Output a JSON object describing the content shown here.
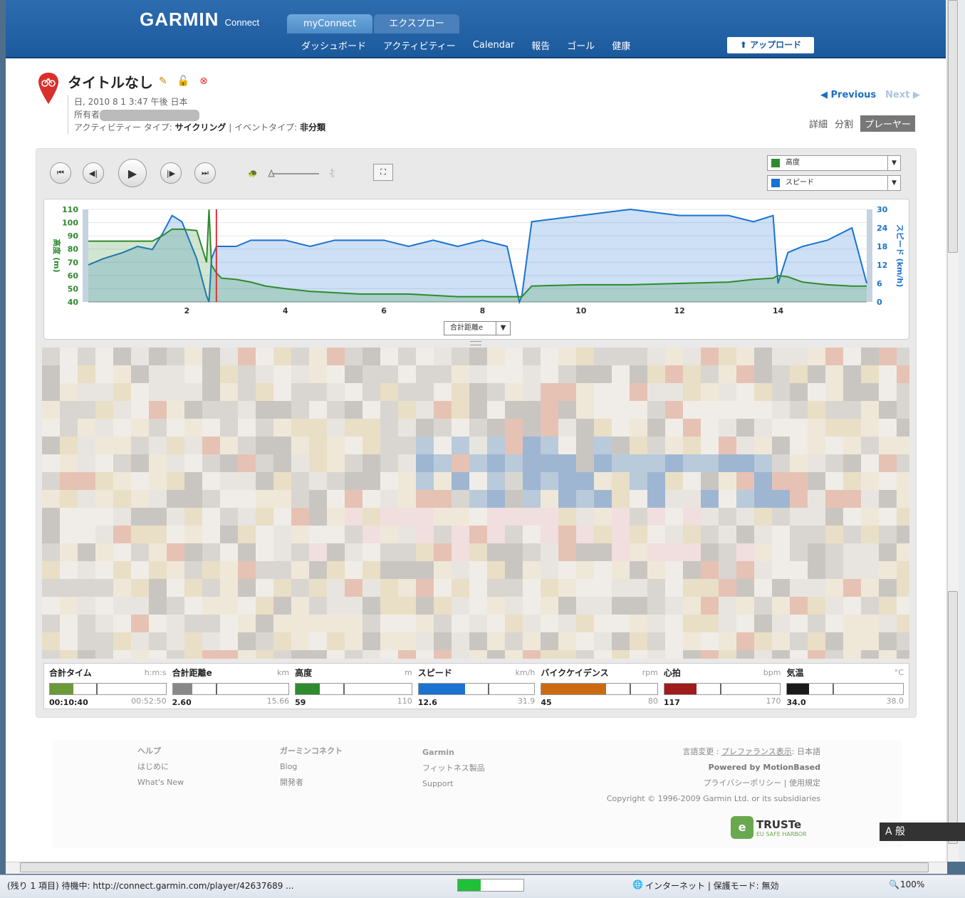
{
  "header": {
    "logo": "GARMIN",
    "logo_sub": "Connect",
    "tabs": [
      "myConnect",
      "エクスプロー"
    ],
    "nav": [
      "ダッシュボード",
      "アクティビティー",
      "Calendar",
      "報告",
      "ゴール",
      "健康"
    ],
    "upload": "アップロード"
  },
  "activity": {
    "title": "タイトルなし",
    "date": "日, 2010 8 1 3:47 午後 日本",
    "owner_label": "所有者",
    "type_label": "アクティビティー タイプ:",
    "type_value": "サイクリング",
    "event_label": "| イベントタイプ:",
    "event_value": "非分類",
    "previous": "Previous",
    "next": "Next",
    "view_tabs": [
      "詳細",
      "分割",
      "プレーヤー"
    ]
  },
  "colors": {
    "altitude": "#2e8b2e",
    "speed": "#1a73d0",
    "marker": "#d33",
    "header": "#1f5e9f"
  },
  "selectors": {
    "series1": "高度",
    "series2": "スピード",
    "xaxis": "合計距離e"
  },
  "chart_data": {
    "type": "area",
    "x": [
      0.0,
      0.3,
      0.7,
      1.0,
      1.3,
      1.5,
      1.7,
      1.9,
      2.2,
      2.4,
      2.45,
      2.5,
      2.6,
      2.7,
      3.0,
      3.3,
      3.6,
      4.0,
      4.5,
      5.0,
      5.5,
      6.0,
      6.5,
      7.0,
      7.5,
      8.0,
      8.5,
      8.75,
      8.8,
      9.0,
      10.0,
      11.0,
      12.0,
      13.0,
      13.5,
      13.9,
      14.0,
      14.2,
      14.5,
      15.0,
      15.5,
      15.8
    ],
    "series": [
      {
        "name": "高度",
        "axis": "left",
        "unit": "m",
        "values": [
          86,
          86,
          86,
          86,
          86,
          90,
          95,
          95,
          94,
          70,
          110,
          68,
          62,
          58,
          57,
          55,
          52,
          50,
          48,
          47,
          46,
          46,
          46,
          45,
          44,
          44,
          44,
          44,
          44,
          52,
          53,
          53,
          54,
          55,
          57,
          58,
          60,
          59,
          55,
          53,
          52,
          52
        ]
      },
      {
        "name": "スピード",
        "axis": "right",
        "unit": "km/h",
        "values": [
          12,
          14,
          16,
          18,
          17,
          22,
          28,
          26,
          14,
          2,
          0,
          14,
          18,
          18,
          18,
          20,
          20,
          20,
          18,
          20,
          20,
          20,
          18,
          20,
          18,
          20,
          18,
          0,
          2,
          26,
          28,
          30,
          28,
          28,
          26,
          28,
          6,
          16,
          18,
          20,
          24,
          6
        ]
      }
    ],
    "ylabel_left": "高度 (m)",
    "ylabel_right": "スピード (km/h)",
    "ylim_left": [
      40,
      110
    ],
    "ylim_right": [
      0,
      30
    ],
    "yticks_left": [
      "110",
      "100",
      "90",
      "80",
      "70",
      "60",
      "50",
      "40"
    ],
    "yticks_right": [
      "30",
      "24",
      "18",
      "12",
      "6",
      "0"
    ],
    "xticks": [
      "2",
      "4",
      "6",
      "8",
      "10",
      "12",
      "14"
    ],
    "xlim": [
      0,
      15.8
    ],
    "marker_x": 2.6
  },
  "stats": [
    {
      "name": "合計タイム",
      "unit": "h:m:s",
      "value": "00:10:40",
      "max": "00:52:50",
      "fraction": 0.2,
      "color": "#6b9a3a"
    },
    {
      "name": "合計距離e",
      "unit": "km",
      "value": "2.60",
      "max": "15.66",
      "fraction": 0.17,
      "color": "#888888"
    },
    {
      "name": "高度",
      "unit": "m",
      "value": "59",
      "max": "110",
      "fraction": 0.21,
      "color": "#2e8b2e"
    },
    {
      "name": "スピード",
      "unit": "km/h",
      "value": "12.6",
      "max": "31.9",
      "fraction": 0.4,
      "color": "#1a73d0"
    },
    {
      "name": "バイクケイデンス",
      "unit": "rpm",
      "value": "45",
      "max": "80",
      "fraction": 0.56,
      "color": "#cc6a12"
    },
    {
      "name": "心拍",
      "unit": "bpm",
      "value": "117",
      "max": "170",
      "fraction": 0.28,
      "color": "#a01c1c"
    },
    {
      "name": "気温",
      "unit": "°C",
      "value": "34.0",
      "max": "38.0",
      "fraction": 0.19,
      "color": "#1a1a1a"
    }
  ],
  "footer": {
    "help": "ヘルプ",
    "help_links": [
      "はじめに",
      "What's New"
    ],
    "gc": "ガーミンコネクト",
    "gc_links": [
      "Blog",
      "開発者"
    ],
    "garmin": "Garmin",
    "garmin_links": [
      "フィットネス製品",
      "Support"
    ],
    "lang": "言語変更 :",
    "pref": "プレファランス表示",
    "jp": ": 日本語",
    "powered": "Powered by MotionBased",
    "privacy": "プライバシーポリシー | 使用規定",
    "copyright": "Copyright © 1996-2009 Garmin Ltd. or its subsidiaries",
    "truste": "TRUSTe",
    "truste_sub": "EU SAFE HARBOR"
  },
  "statusbar": {
    "loading": "(残り 1 項目) 待機中: http://connect.garmin.com/player/42637689 ...",
    "zone": "インターネット | 保護モード: 無効",
    "zoom": "100%"
  },
  "ime": "A 般"
}
